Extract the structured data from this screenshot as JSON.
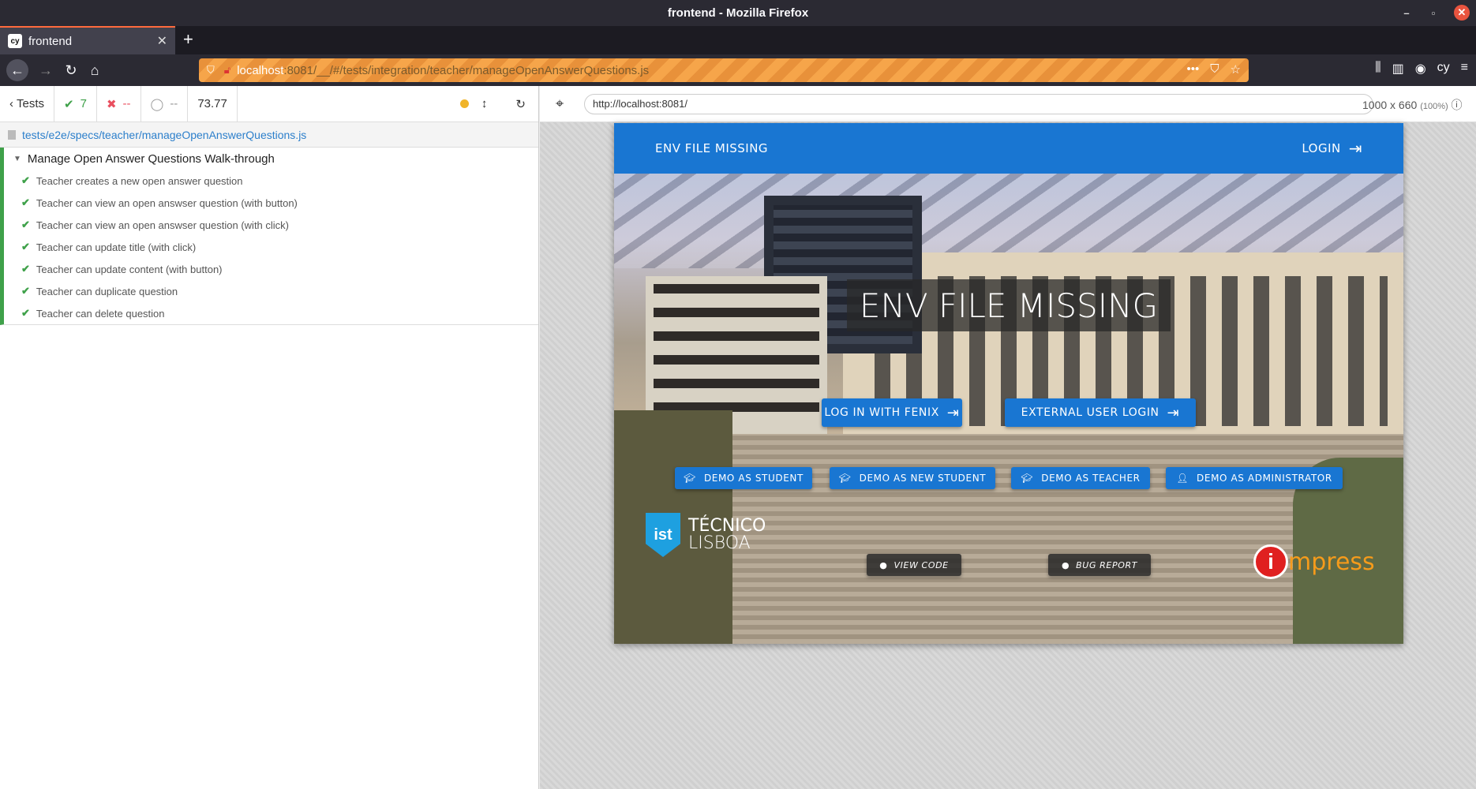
{
  "window": {
    "title": "frontend - Mozilla Firefox"
  },
  "tab": {
    "favicon": "cy",
    "label": "frontend"
  },
  "urlbar": {
    "host": "localhost",
    "rest": ":8081/__/#/tests/integration/teacher/manageOpenAnswerQuestions.js"
  },
  "reporter": {
    "tests_label": "Tests",
    "passed": "7",
    "failed": "--",
    "pending": "--",
    "duration": "73.77",
    "spec_path": "tests/e2e/specs/teacher/manageOpenAnswerQuestions.js",
    "suite_title": "Manage Open Answer Questions Walk-through",
    "tests": [
      "Teacher creates a new open answer question",
      "Teacher can view an open answser question (with button)",
      "Teacher can view an open answser question (with click)",
      "Teacher can update title (with click)",
      "Teacher can update content (with button)",
      "Teacher can duplicate question",
      "Teacher can delete question"
    ]
  },
  "aut": {
    "url": "http://localhost:8081/",
    "size": "1000 x 660",
    "zoom": "(100%)"
  },
  "app": {
    "brand": "ENV FILE MISSING",
    "login_label": "LOGIN",
    "hero_title": "ENV FILE MISSING",
    "fenix_button": "LOG IN WITH FENIX",
    "external_button": "EXTERNAL USER LOGIN",
    "demo_buttons": [
      "DEMO AS STUDENT",
      "DEMO AS NEW STUDENT",
      "DEMO AS TEACHER",
      "DEMO AS ADMINISTRATOR"
    ],
    "view_code": "VIEW CODE",
    "bug_report": "BUG REPORT",
    "tecnico_line1": "TÉCNICO",
    "tecnico_line2": "LISBOA",
    "impress": "mpress"
  },
  "colors": {
    "primary": "#1976d2",
    "passed": "#3fa14a",
    "failed": "#e94f5f",
    "impress": "#f59b1b"
  }
}
